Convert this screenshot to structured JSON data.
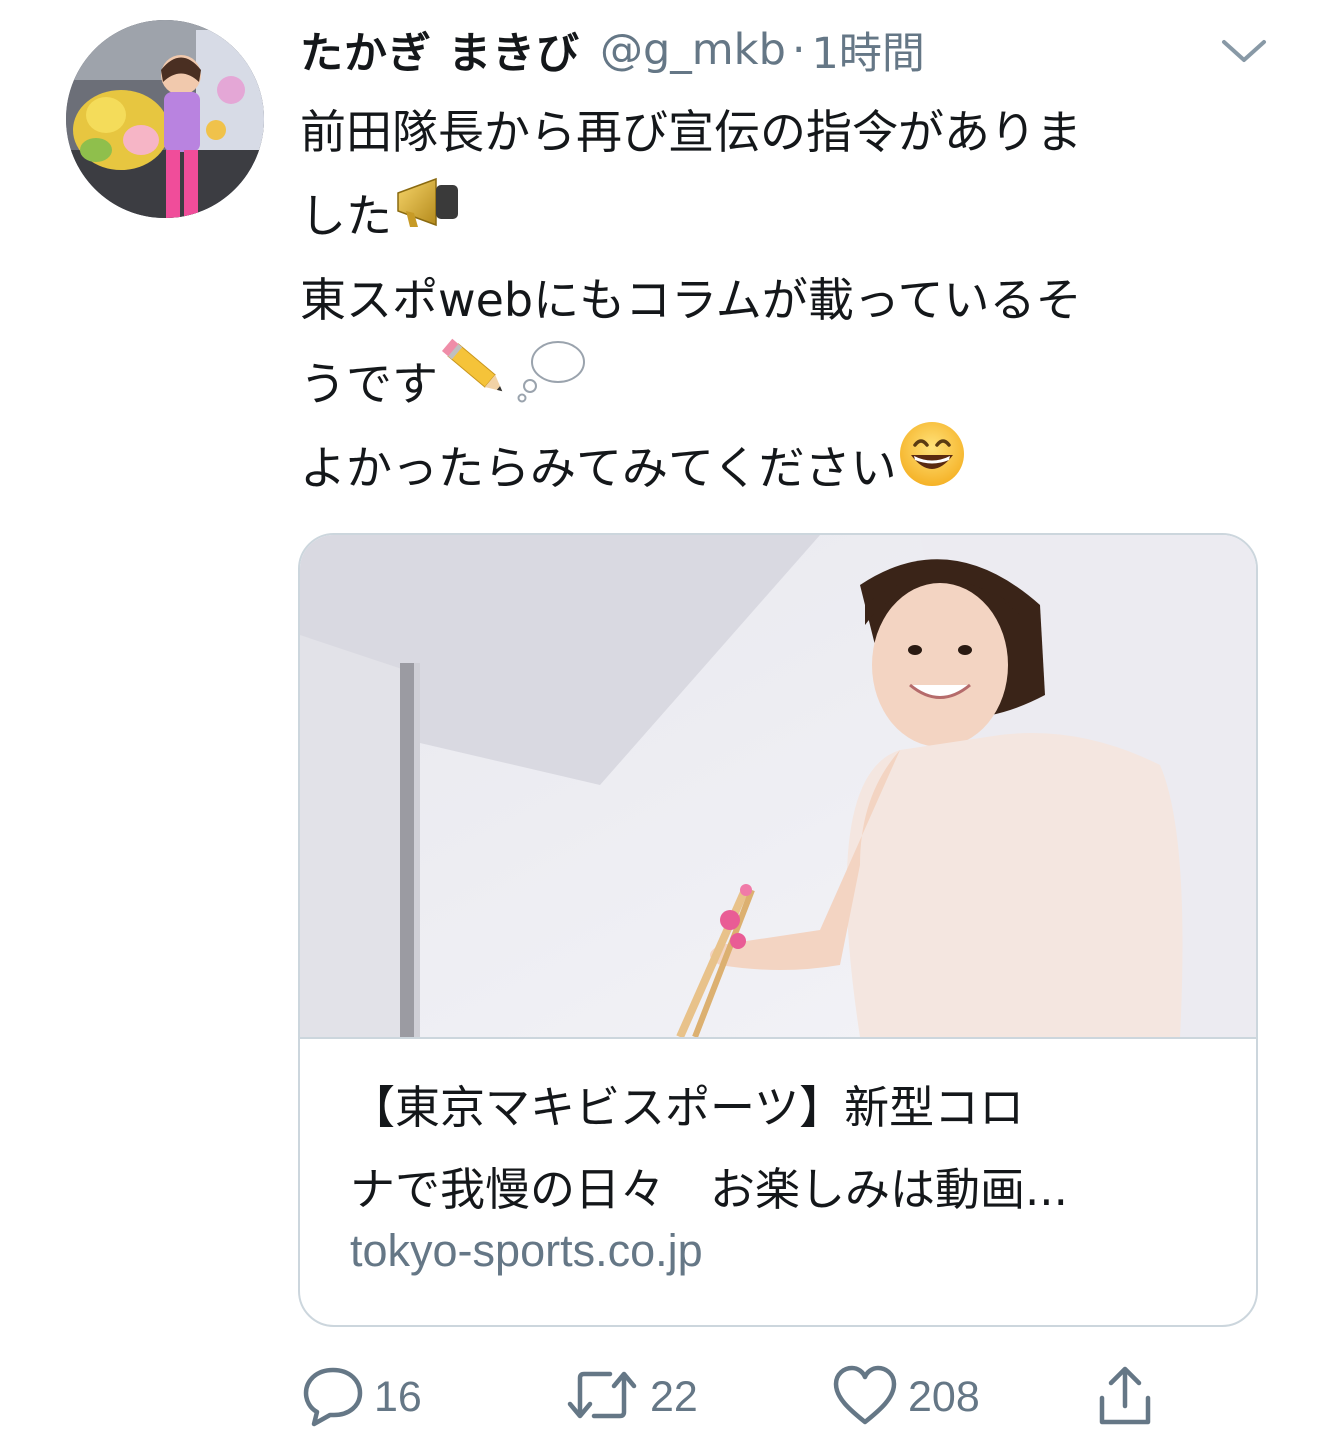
{
  "author": {
    "display_name": "たかぎ まきび",
    "handle": "@g_mkb",
    "separator": "·",
    "time": "1時間"
  },
  "body": {
    "line1": "前田隊長から再び宣伝の指令がありま",
    "line2": "した",
    "line2_emoji": "megaphone-emoji",
    "line3": "東スポwebにもコラムが載っているそ",
    "line4": "うです",
    "line4_emojis": [
      "pencil-emoji",
      "thought-balloon-emoji"
    ],
    "line5": "よかったらみてみてください",
    "line5_emoji": "grinning-face-emoji"
  },
  "card": {
    "title_line1": "【東京マキビスポーツ】新型コロ",
    "title_line2": "ナで我慢の日々　お楽しみは動画...",
    "domain": "tokyo-sports.co.jp"
  },
  "actions": {
    "replies": "16",
    "retweets": "22",
    "likes": "208"
  },
  "icons": {
    "menu": "chevron-down-icon",
    "reply": "reply-icon",
    "retweet": "retweet-icon",
    "like": "heart-icon",
    "share": "share-icon"
  },
  "colors": {
    "text": "#14171a",
    "secondary": "#657786",
    "border": "#ccd6dd"
  }
}
